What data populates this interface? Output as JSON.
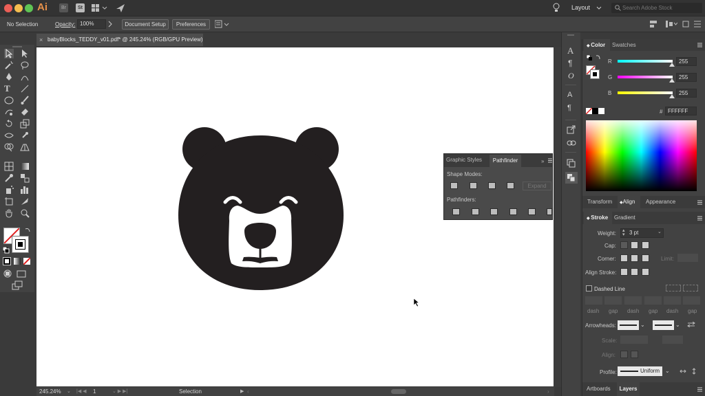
{
  "app": {
    "logo_text": "Ai",
    "bridge_label": "Br",
    "stock_label": "St",
    "layout_label": "Layout",
    "search_placeholder": "Search Adobe Stock"
  },
  "control_bar": {
    "selection_status": "No Selection",
    "opacity_label": "Opacity:",
    "opacity_value": "100%",
    "document_setup_label": "Document Setup",
    "preferences_label": "Preferences"
  },
  "document_tab": {
    "title": "babyBlocks_TEDDY_v01.pdf* @ 245.24% (RGB/GPU Preview)"
  },
  "status_bar": {
    "zoom": "245.24%",
    "artboard_number": "1",
    "tool_name": "Selection"
  },
  "pathfinder_panel": {
    "tabs": [
      "Graphic Styles",
      "Pathfinder"
    ],
    "shape_modes_label": "Shape Modes:",
    "expand_label": "Expand",
    "pathfinders_label": "Pathfinders:"
  },
  "color_panel": {
    "tabs": [
      "Color",
      "Swatches"
    ],
    "channels": [
      {
        "name": "R",
        "value": "255"
      },
      {
        "name": "G",
        "value": "255"
      },
      {
        "name": "B",
        "value": "255"
      }
    ],
    "hex_symbol": "#",
    "hex_value": "FFFFFF"
  },
  "transform_group": {
    "tabs": [
      "Transform",
      "Align",
      "Appearance"
    ]
  },
  "stroke_panel": {
    "tabs": [
      "Stroke",
      "Gradient"
    ],
    "weight_label": "Weight:",
    "weight_value": "3 pt",
    "cap_label": "Cap:",
    "corner_label": "Corner:",
    "limit_label": "Limit:",
    "align_stroke_label": "Align Stroke:",
    "dashed_line_label": "Dashed Line",
    "dash_labels": [
      "dash",
      "gap",
      "dash",
      "gap",
      "dash",
      "gap"
    ],
    "arrowheads_label": "Arrowheads:",
    "scale_label": "Scale:",
    "align_label": "Align:",
    "profile_label": "Profile:",
    "profile_value": "Uniform"
  },
  "bottom_tabs": {
    "tabs": [
      "Artboards",
      "Layers"
    ]
  }
}
